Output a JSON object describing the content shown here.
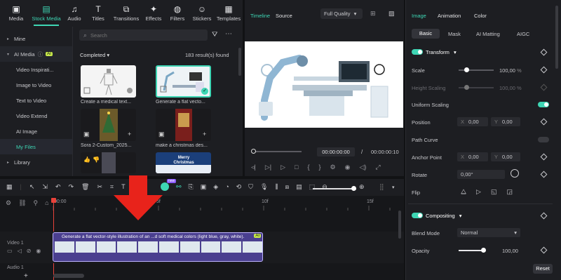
{
  "media_tabs": [
    {
      "label": "Media",
      "icon": "media-icon",
      "glyph": "▣"
    },
    {
      "label": "Stock Media",
      "icon": "stock-media-icon",
      "glyph": "▤"
    },
    {
      "label": "Audio",
      "icon": "audio-icon",
      "glyph": "♫"
    },
    {
      "label": "Titles",
      "icon": "titles-icon",
      "glyph": "T"
    },
    {
      "label": "Transitions",
      "icon": "transitions-icon",
      "glyph": "⧉"
    },
    {
      "label": "Effects",
      "icon": "effects-icon",
      "glyph": "✦"
    },
    {
      "label": "Filters",
      "icon": "filters-icon",
      "glyph": "◍"
    },
    {
      "label": "Stickers",
      "icon": "stickers-icon",
      "glyph": "☺"
    },
    {
      "label": "Templates",
      "icon": "templates-icon",
      "glyph": "▦"
    }
  ],
  "sidebar": {
    "mine": "Mine",
    "ai_media": "AI Media",
    "ai_badge": "AI",
    "items": [
      "Video Inspirati...",
      "Image to Video",
      "Text to Video",
      "Video Extend",
      "AI Image",
      "My Files"
    ],
    "library": "Library"
  },
  "search": {
    "placeholder": "Search"
  },
  "media": {
    "filter_label": "Completed",
    "results": "183 result(s) found",
    "cards": [
      {
        "caption": "Create a medical text..."
      },
      {
        "caption": "Generate a flat vecto..."
      },
      {
        "caption": "Sora 2-Custom_2025..."
      },
      {
        "caption": "make a christmas des..."
      },
      {
        "caption": ""
      },
      {
        "caption": "Merry Christmas"
      }
    ]
  },
  "preview": {
    "tab_timeline": "Timeline",
    "tab_source": "Source",
    "quality": "Full Quality",
    "current_time": "00:00:00:00",
    "separator": "/",
    "total_time": "00:00:00:10"
  },
  "props": {
    "tabs": [
      "Image",
      "Animation",
      "Color"
    ],
    "subtabs": [
      "Basic",
      "Mask",
      "AI Matting",
      "AIGC"
    ],
    "transform": "Transform",
    "scale_label": "Scale",
    "scale_value": "100,00",
    "scale_unit": "%",
    "hscale_label": "Height Scaling",
    "hscale_value": "100,00",
    "hscale_unit": "%",
    "uniform_label": "Uniform Scaling",
    "position_label": "Position",
    "pos_x_label": "X",
    "pos_x": "0,00",
    "pos_y_label": "Y",
    "pos_y": "0,00",
    "path_curve": "Path Curve",
    "anchor_label": "Anchor Point",
    "anchor_x_label": "X",
    "anchor_x": "0,00",
    "anchor_y_label": "Y",
    "anchor_y": "0,00",
    "rotate_label": "Rotate",
    "rotate_value": "0,00°",
    "flip_label": "Flip",
    "compositing": "Compositing",
    "blend_label": "Blend Mode",
    "blend_value": "Normal",
    "opacity_label": "Opacity",
    "opacity_value": "100,00",
    "reset": "Reset"
  },
  "timeline": {
    "ruler": [
      "00:00",
      "5f",
      "10f",
      "15f"
    ],
    "video_track": "Video 1",
    "audio_track": "Audio 1",
    "clip_title": "Generate a flat vector-style illustration of an ...d soft medical colors (light blue, gray, white).",
    "clip_badge": "AI",
    "new_badge": "new"
  },
  "colors": {
    "accent": "#3ed6b4",
    "clip": "#4a3f8f",
    "arrow": "#e8231b"
  }
}
